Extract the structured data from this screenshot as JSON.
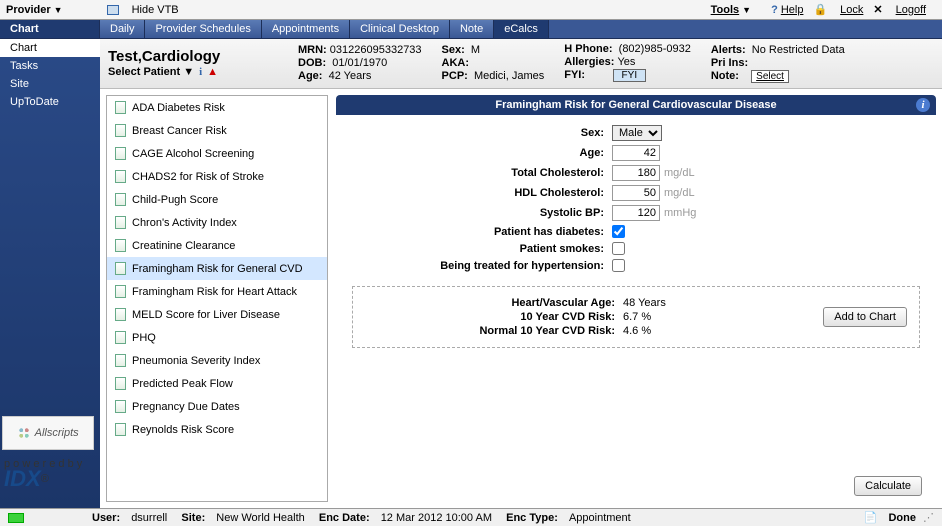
{
  "toolbar": {
    "provider_label": "Provider",
    "hide_vtb": "Hide VTB",
    "tools": "Tools",
    "help": "Help",
    "lock": "Lock",
    "logoff": "Logoff"
  },
  "tabs": {
    "side": "Chart",
    "items": [
      "Daily",
      "Provider Schedules",
      "Appointments",
      "Clinical Desktop",
      "Note",
      "eCalcs"
    ],
    "selected": "eCalcs"
  },
  "sidepanel": {
    "items": [
      "Chart",
      "Tasks",
      "Site",
      "UpToDate"
    ],
    "active": "Chart"
  },
  "patient": {
    "name": "Test,Cardiology",
    "select_label": "Select Patient",
    "mrn_l": "MRN:",
    "mrn": "031226095332733",
    "dob_l": "DOB:",
    "dob": "01/01/1970",
    "age_l": "Age:",
    "age": "42 Years",
    "sex_l": "Sex:",
    "sex": "M",
    "aka_l": "AKA:",
    "aka": "",
    "pcp_l": "PCP:",
    "pcp": "Medici, James",
    "hphone_l": "H Phone:",
    "hphone": "(802)985-0932",
    "allergies_l": "Allergies:",
    "allergies": "Yes",
    "fyi_l": "FYI:",
    "fyi_btn": "FYI",
    "alerts_l": "Alerts:",
    "alerts": "No Restricted Data",
    "prins_l": "Pri Ins:",
    "prins": "",
    "note_l": "Note:",
    "note_btn": "Select"
  },
  "calc_list": [
    "ADA Diabetes Risk",
    "Breast Cancer Risk",
    "CAGE Alcohol Screening",
    "CHADS2 for Risk of Stroke",
    "Child-Pugh Score",
    "Chron's Activity Index",
    "Creatinine Clearance",
    "Framingham Risk for General CVD",
    "Framingham Risk for Heart Attack",
    "MELD Score for Liver Disease",
    "PHQ",
    "Pneumonia Severity Index",
    "Predicted Peak Flow",
    "Pregnancy Due Dates",
    "Reynolds Risk Score"
  ],
  "calc_selected": "Framingham Risk for General CVD",
  "calc_title": "Framingham Risk for General Cardiovascular Disease",
  "form": {
    "sex_l": "Sex:",
    "sex_val": "Male",
    "age_l": "Age:",
    "age_val": "42",
    "tc_l": "Total Cholesterol:",
    "tc_val": "180",
    "tc_unit": "mg/dL",
    "hdl_l": "HDL Cholesterol:",
    "hdl_val": "50",
    "hdl_unit": "mg/dL",
    "sbp_l": "Systolic BP:",
    "sbp_val": "120",
    "sbp_unit": "mmHg",
    "diab_l": "Patient has diabetes:",
    "diab_checked": true,
    "smoke_l": "Patient smokes:",
    "smoke_checked": false,
    "htn_l": "Being treated for hypertension:",
    "htn_checked": false
  },
  "results": {
    "hva_l": "Heart/Vascular Age:",
    "hva": "48 Years",
    "cvd_l": "10 Year CVD Risk:",
    "cvd": "6.7 %",
    "ncvd_l": "Normal 10 Year CVD Risk:",
    "ncvd": "4.6 %",
    "add_btn": "Add to Chart",
    "calc_btn": "Calculate"
  },
  "logos": {
    "allscripts": "Allscripts",
    "powered": "p o w e r e d   b y",
    "idx": "IDX"
  },
  "status": {
    "user_l": "User:",
    "user": "dsurrell",
    "site_l": "Site:",
    "site": "New World Health",
    "enc_l": "Enc Date:",
    "enc": "12 Mar 2012 10:00 AM",
    "type_l": "Enc Type:",
    "type": "Appointment",
    "done": "Done"
  }
}
